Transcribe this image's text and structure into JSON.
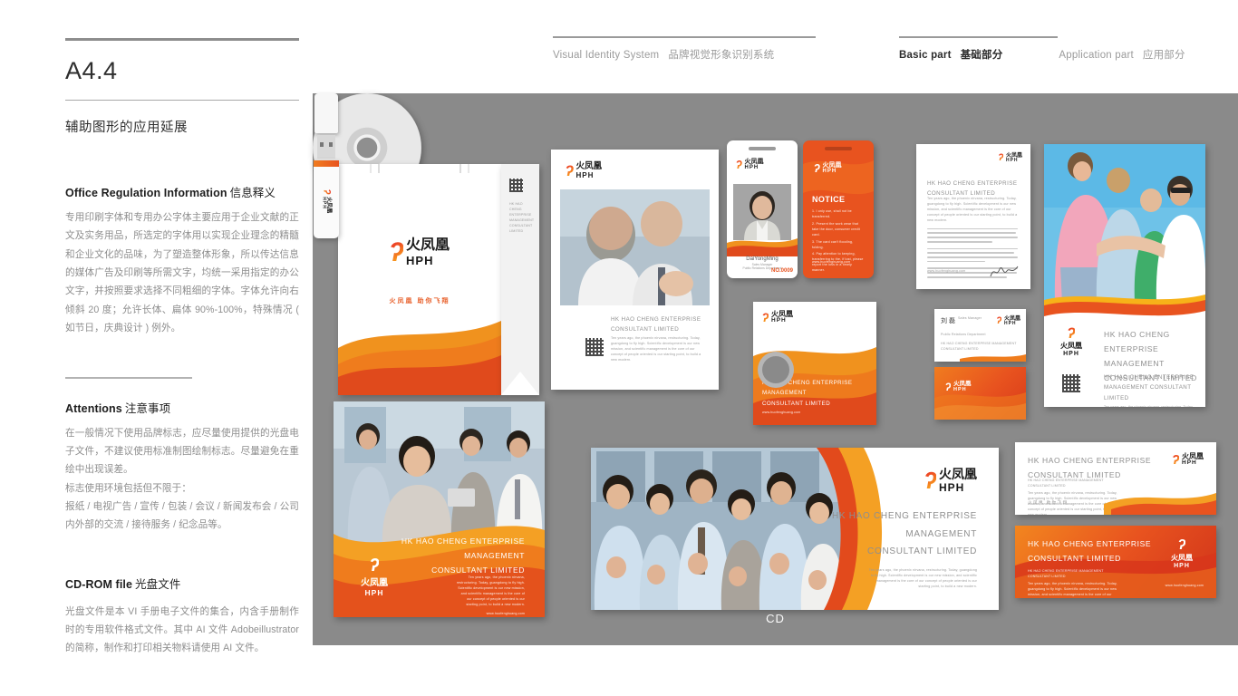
{
  "header": {
    "left_group": {
      "en": "Visual Identity System",
      "cn": "品牌视觉形象识别系统"
    },
    "basic_part": {
      "en": "Basic part",
      "cn": "基础部分"
    },
    "application_part": {
      "en": "Application part",
      "cn": "应用部分"
    }
  },
  "left_column": {
    "doc_code": "A4.4",
    "doc_subtitle": "辅助图形的应用延展",
    "sections": [
      {
        "title_en": "Office Regulation Information",
        "title_cn": "信息释义",
        "body": "专用印刷字体和专用办公字体主要应用于企业文献的正文及实务用品，所选定的字体用以实现企业理念的精髓和企业文化的品味，为了塑造整体形象，所以传达信息的媒体广告及印刷等所需文字，均统一采用指定的办公文字，并按照要求选择不同粗细的字体。字体允许向右倾斜 20 度；允许长体、扁体 90%-100%，特殊情况 ( 如节日，庆典设计 ) 例外。"
      },
      {
        "title_en": "Attentions",
        "title_cn": "注意事项",
        "body": "在一般情况下使用品牌标志，应尽量使用提供的光盘电子文件，不建议使用标准制图绘制标志。尽量避免在重绘中出现误差。",
        "body2": "标志使用环境包括但不限于：",
        "body3": "报纸 / 电视广告 / 宣传 / 包装 / 会议 / 新闻发布会 / 公司内外部的交流 / 接待服务 / 纪念品等。"
      },
      {
        "title_en": "CD-ROM file",
        "title_cn": "光盘文件",
        "body": "光盘文件是本 VI 手册电子文件的集合，内含手册制作时的专用软件格式文件。其中 AI 文件 Adobeillustrator 的简称，制作和打印相关物料请使用 AI 文件。"
      }
    ]
  },
  "brand": {
    "mark_glyph": "ʔ",
    "name_cn": "火凤凰",
    "name_en": "HPH",
    "tagline_cn": "火凤凰  助你飞翔",
    "website": "www.huofenghuang.com",
    "company_line1": "HK HAO CHENG ENTERPRISE",
    "company_line2": "MANAGEMENT",
    "company_line3": "CONSULTANT LIMITED",
    "company_full": "HK HAO CHENG ENTERPRISE MANAGEMENT CONSULTANT LIMITED",
    "body_copy": "Ten years ago, the phoenix nirvana, restructuring. Today, guangdong to fly high. Scientific development is our new mission, and scientific management is the core of our concept of people oriented is our starting point, to build a new modern."
  },
  "colors": {
    "canvas_gray": "#8a8a8a",
    "brand_red": "#e8262a",
    "brand_orange": "#f05a23",
    "brand_amber": "#f7941e",
    "brand_yellow": "#fdb913",
    "text_dark": "#2e2e2e",
    "text_muted": "#8e8e8e"
  },
  "mockups": {
    "bag": {
      "name": "shopping-bag"
    },
    "brochure": {
      "name": "brochure-cover"
    },
    "id_badge": {
      "person_name": "DaiYongMing",
      "job_title": "Sales Manager",
      "department": "Public Relations Department",
      "number": "NO.0009"
    },
    "notice_card": {
      "heading": "NOTICE",
      "items": [
        "1. I only use, shall not be transferred.",
        "2. Present the work wear that take the door, consumer credit card.",
        "3. The card can't flooding, folding.",
        "4. Pay attention to keeping, transferring to the, if lost, please report the loss in a timely manner."
      ],
      "website": "www.huofenghuang.com"
    },
    "letterhead": {
      "name": "letterhead"
    },
    "cd_sleeve": {
      "label": "CD"
    },
    "business_card": {
      "person_name": "刘 磊"
    },
    "poster": {
      "name": "lifestyle-poster"
    },
    "bottom_poster": {
      "name": "office-poster"
    },
    "usb": {
      "name": "usb-flash-drive"
    },
    "team_banner": {
      "name": "team-banner"
    },
    "envelopes": {
      "name": "envelope-pair"
    }
  }
}
